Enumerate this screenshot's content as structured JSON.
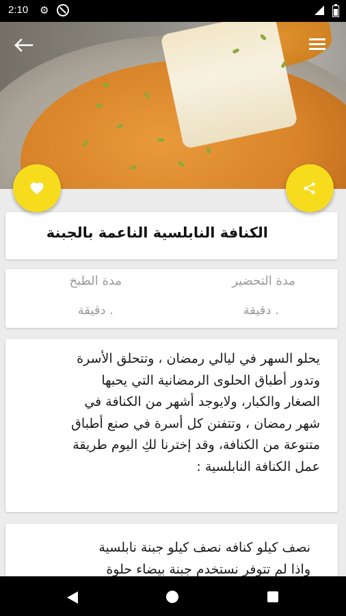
{
  "status_bar": {
    "time": "2:10",
    "icons": [
      "gear-icon",
      "do-not-disturb-icon",
      "signal-icon",
      "battery-icon"
    ]
  },
  "toolbar": {
    "back_icon": "arrow-left-icon",
    "menu_icon": "hamburger-menu-icon"
  },
  "hero": {
    "image": "kunafa-with-melted-cheese-photo"
  },
  "actions": {
    "favorite_icon": "heart-icon",
    "share_icon": "share-icon",
    "accent_color": "#f7dc1d"
  },
  "recipe": {
    "title": "الكنافة النابلسية الناعمة بالجبنة",
    "prep_label": "مدة التحضير",
    "prep_value": ". دقيقة",
    "cook_label": "مدة الطبخ",
    "cook_value": ". دقيقة",
    "description_lines": [
      "يحلو السهر في ليالي رمضان ، وتتحلق الأسرة",
      "وتدور أطباق الحلوى الرمضانية التي يحبها",
      "الصغار والكبار، ولايوجد أشهر من الكنافة في",
      "شهر رمضان ، وتتفنن كل أسرة في صنع أطباق",
      "متنوعة من الكنافة، وقد إخترنا لكِ اليوم طريقة",
      "عمل الكنافة النابلسية :"
    ],
    "ingredients_lines": [
      "نصف كيلو كنافه نصف كيلو جبنة نابلسية",
      "واذا لم تتوفر نستخدم جبنة بيضاء حلوة"
    ]
  },
  "nav_bar": {
    "icons": [
      "back-triangle-icon",
      "home-circle-icon",
      "recents-square-icon"
    ]
  }
}
